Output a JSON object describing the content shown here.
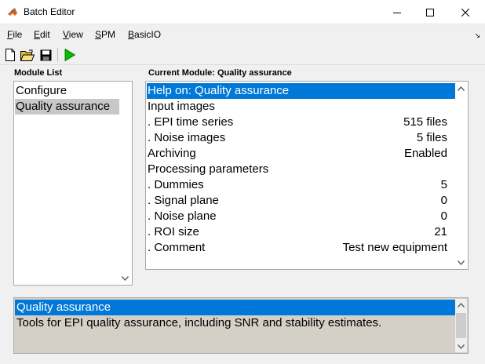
{
  "window": {
    "title": "Batch Editor",
    "controls": [
      "minimize",
      "maximize",
      "close"
    ]
  },
  "menu": {
    "items": [
      {
        "label": "File",
        "underline": "F",
        "rest": "ile"
      },
      {
        "label": "Edit",
        "underline": "E",
        "rest": "dit"
      },
      {
        "label": "View",
        "underline": "V",
        "rest": "iew"
      },
      {
        "label": "SPM",
        "underline": "S",
        "rest": "PM"
      },
      {
        "label": "BasicIO",
        "underline": "B",
        "rest": "asicIO"
      }
    ],
    "corner_glyph": "↘"
  },
  "toolbar": {
    "buttons": [
      "new-file-icon",
      "open-folder-icon",
      "save-icon",
      "run-icon"
    ],
    "colors": {
      "run": "#00c000"
    }
  },
  "module_list": {
    "label": "Module List",
    "items": [
      "Configure",
      "Quality assurance"
    ],
    "selected_index": 1
  },
  "current_module": {
    "label": "Current Module: Quality assurance",
    "rows": [
      {
        "label": "Help on: Quality assurance",
        "value": ""
      },
      {
        "label": "Input images",
        "value": ""
      },
      {
        "label": ". EPI time series",
        "value": "515 files"
      },
      {
        "label": ". Noise images",
        "value": "5 files"
      },
      {
        "label": "Archiving",
        "value": "Enabled"
      },
      {
        "label": "Processing parameters",
        "value": ""
      },
      {
        "label": ". Dummies",
        "value": "5"
      },
      {
        "label": ". Signal plane",
        "value": "0"
      },
      {
        "label": ". Noise plane",
        "value": "0"
      },
      {
        "label": ". ROI size",
        "value": "21"
      },
      {
        "label": ". Comment",
        "value": "Test new equipment"
      }
    ],
    "selected_index": 0
  },
  "description": {
    "title": "Quality assurance",
    "text": "Tools for EPI quality assurance, including SNR and stability estimates."
  },
  "colors": {
    "selection_blue": "#0078d7",
    "selection_grey": "#c8c8c8"
  }
}
